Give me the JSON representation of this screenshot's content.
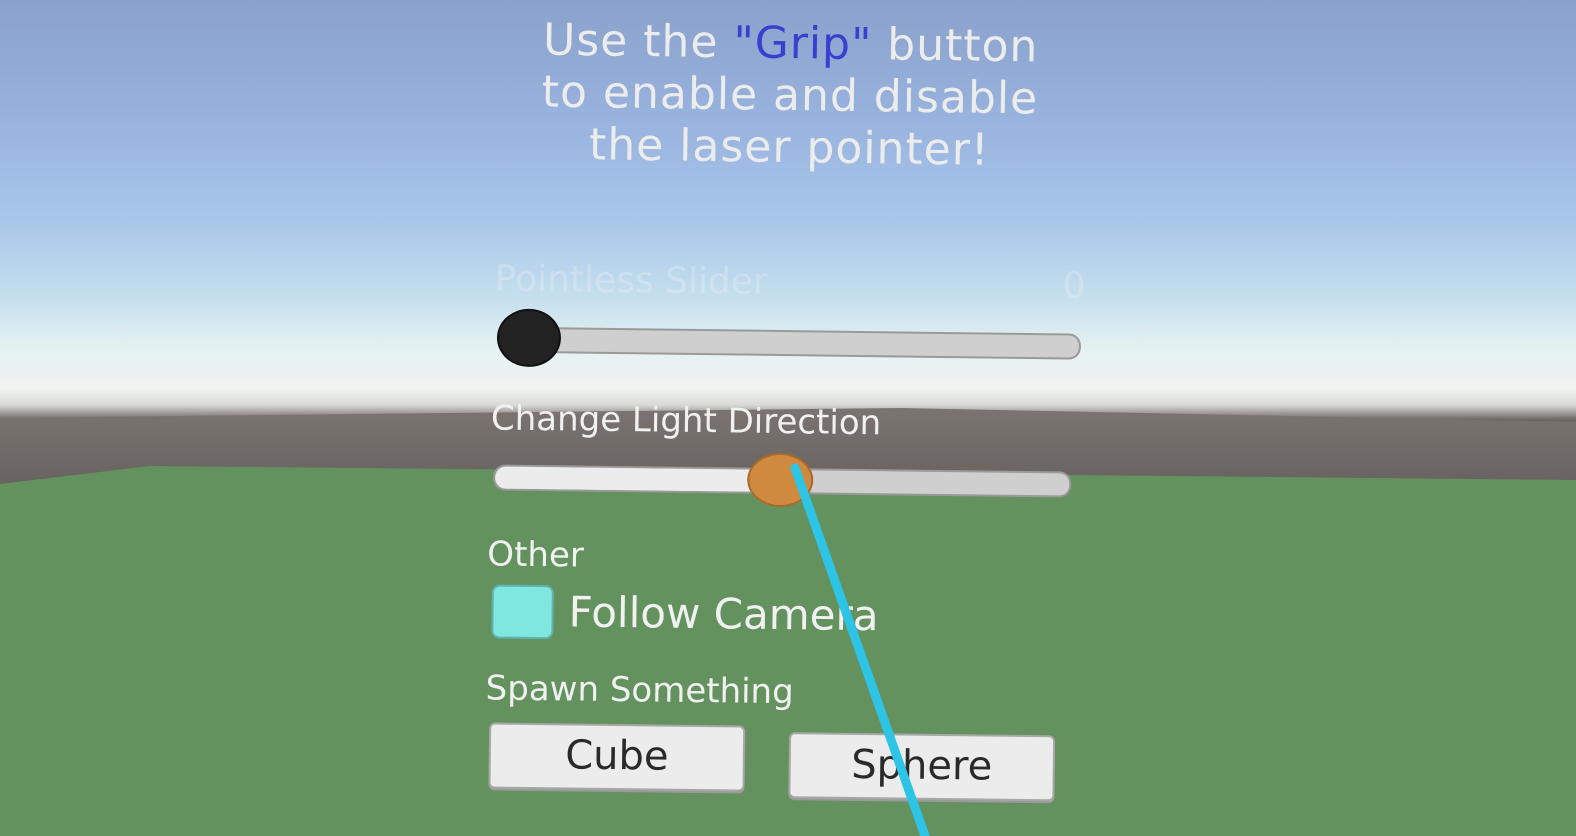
{
  "instructions": {
    "line1_pre": "Use the ",
    "line1_grip": "\"Grip\"",
    "line1_post": " button",
    "line2": "to enable and disable",
    "line3": "the laser pointer!"
  },
  "pointless_slider": {
    "label": "Pointless Slider",
    "value_text": "0",
    "value": 0
  },
  "light_slider": {
    "label": "Change Light Direction",
    "value_fraction": 0.5
  },
  "other": {
    "heading": "Other",
    "follow_camera_label": "Follow Camera",
    "follow_camera_checked": true
  },
  "spawn": {
    "heading": "Spawn Something",
    "cube_label": "Cube",
    "sphere_label": "Sphere"
  },
  "colors": {
    "grip_highlight": "#3a3fd0",
    "laser": "#2ec4e6",
    "checkbox": "#7fe6e0",
    "light_knob": "#d08a40",
    "ground": "#64925f"
  },
  "icons": {
    "laser": "laser-pointer-beam"
  }
}
